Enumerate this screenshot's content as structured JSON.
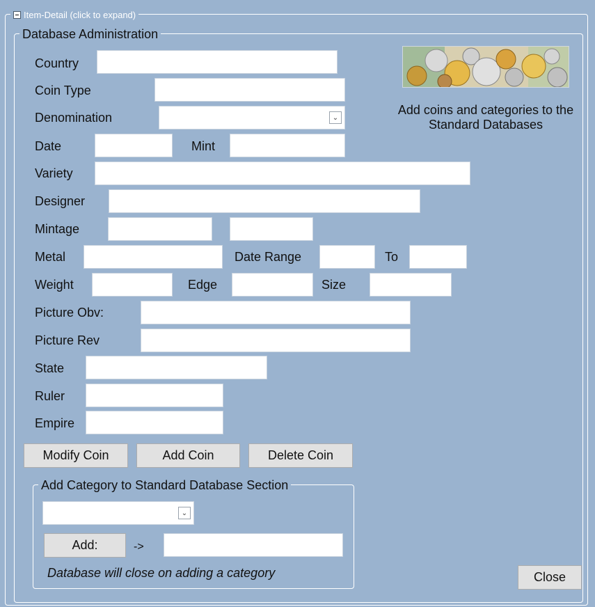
{
  "header": {
    "collapse_label": "Item-Detail (click to expand)",
    "section_title": "Database Administration"
  },
  "fields": {
    "country": {
      "label": "Country",
      "value": ""
    },
    "coin_type": {
      "label": "Coin Type",
      "value": ""
    },
    "denomination": {
      "label": "Denomination",
      "value": ""
    },
    "date": {
      "label": "Date",
      "value": ""
    },
    "mint": {
      "label": "Mint",
      "value": ""
    },
    "variety": {
      "label": "Variety",
      "value": ""
    },
    "designer": {
      "label": "Designer",
      "value": ""
    },
    "mintage": {
      "label": "Mintage",
      "value": "",
      "value2": ""
    },
    "metal": {
      "label": "Metal",
      "value": ""
    },
    "date_range": {
      "label": "Date Range",
      "from": "",
      "to_label": "To",
      "to": ""
    },
    "weight": {
      "label": "Weight",
      "value": ""
    },
    "edge": {
      "label": "Edge",
      "value": ""
    },
    "size": {
      "label": "Size",
      "value": ""
    },
    "picture_obv": {
      "label": "Picture Obv:",
      "value": ""
    },
    "picture_rev": {
      "label": "Picture Rev",
      "value": ""
    },
    "state": {
      "label": "State",
      "value": ""
    },
    "ruler": {
      "label": "Ruler",
      "value": ""
    },
    "empire": {
      "label": "Empire",
      "value": ""
    }
  },
  "buttons": {
    "modify": "Modify Coin",
    "add": "Add Coin",
    "delete": "Delete Coin",
    "close": "Close"
  },
  "side_panel": {
    "caption": "Add coins and categories to the Standard Databases"
  },
  "category_section": {
    "title": "Add Category to Standard Database Section",
    "select_value": "",
    "add_button": "Add:",
    "arrow": "->",
    "new_category_value": "",
    "note": "Database will close on adding a category"
  },
  "colors": {
    "panel_bg": "#9ab3cf",
    "button_bg": "#e1e1e1",
    "border_white": "#ffffff"
  }
}
